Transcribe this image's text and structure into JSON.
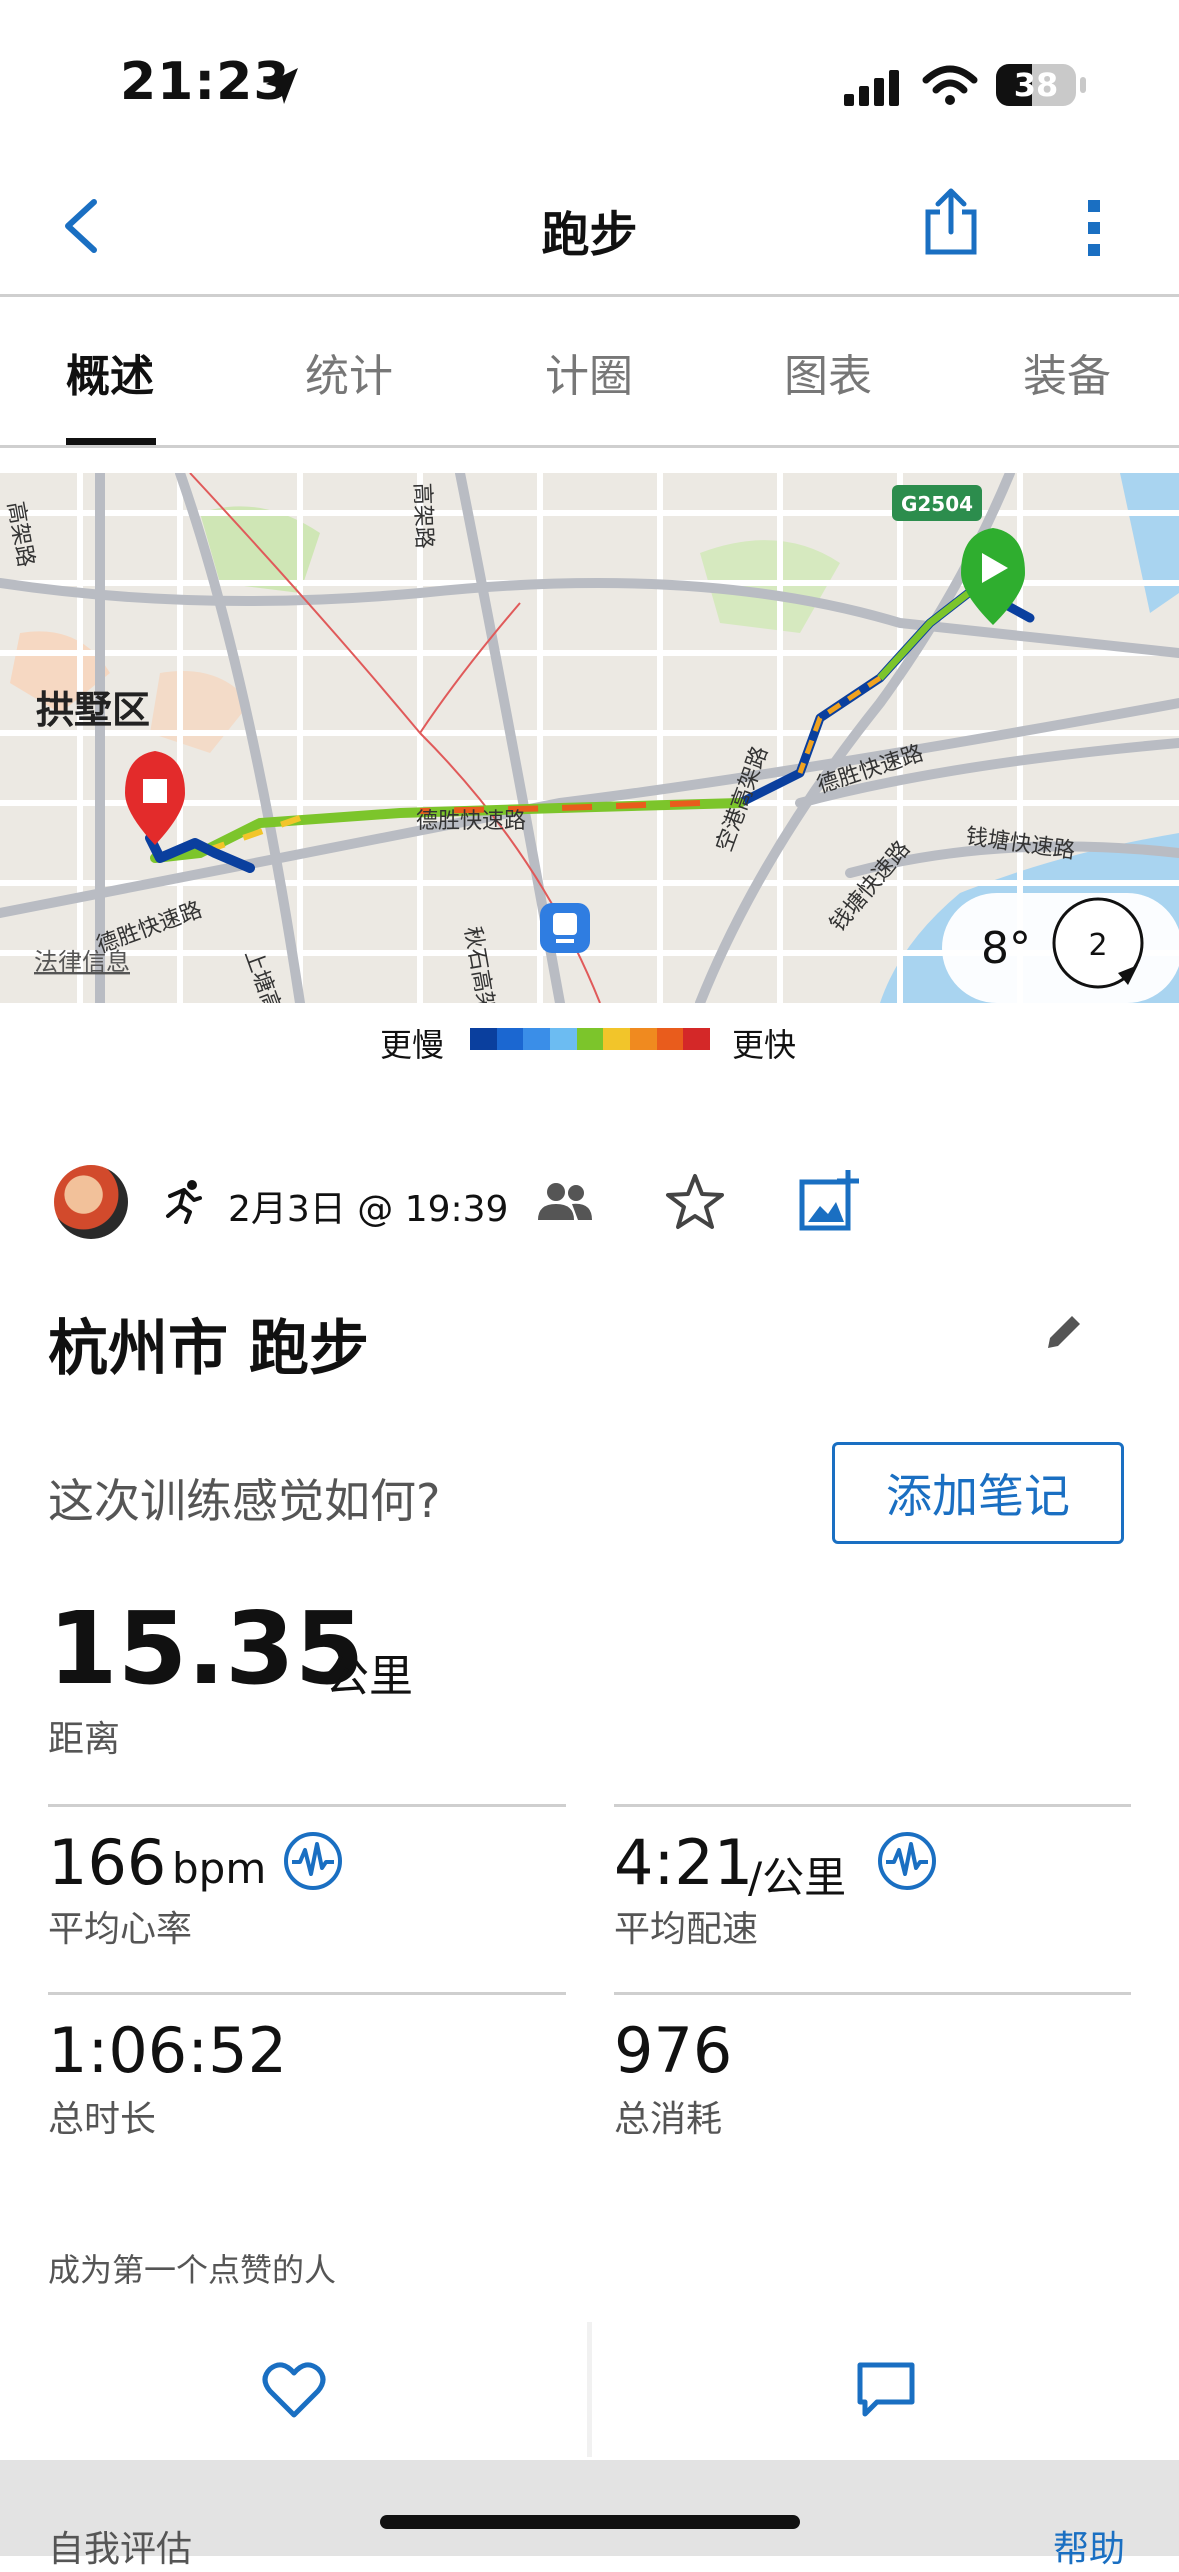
{
  "status_bar": {
    "time": "21:23",
    "battery": "38"
  },
  "header": {
    "title": "跑步"
  },
  "tabs": [
    {
      "label": "概述",
      "active": true
    },
    {
      "label": "统计",
      "active": false
    },
    {
      "label": "计圈",
      "active": false
    },
    {
      "label": "图表",
      "active": false
    },
    {
      "label": "装备",
      "active": false
    }
  ],
  "map": {
    "district": "拱墅区",
    "road_shield": "G2504",
    "road_labels": [
      "德胜快速路",
      "德胜快速路",
      "德胜快速路",
      "上塘高架",
      "秋石高架",
      "空港高架路",
      "钱塘快速路",
      "钱塘快速路",
      "高架路",
      "高架路"
    ],
    "legal": "法律信息",
    "weather_temp": "8°",
    "wind": "2"
  },
  "legend": {
    "slow": "更慢",
    "fast": "更快",
    "colors": [
      "#0a3f9e",
      "#1b67d1",
      "#3a8ee8",
      "#6cbcf2",
      "#7cc52b",
      "#f2c52a",
      "#f08a1f",
      "#e95c1c",
      "#d42828"
    ]
  },
  "activity": {
    "date": "2月3日 @ 19:39",
    "title": "杭州市 跑步",
    "feeling_question": "这次训练感觉如何?",
    "add_note": "添加笔记"
  },
  "stats": {
    "distance": {
      "value": "15.35",
      "unit": "公里",
      "label": "距离"
    },
    "heart_rate": {
      "value": "166",
      "unit": "bpm",
      "label": "平均心率"
    },
    "pace": {
      "value": "4:21",
      "unit": "/公里",
      "label": "平均配速"
    },
    "duration": {
      "value": "1:06:52",
      "label": "总时长"
    },
    "calories": {
      "value": "976",
      "label": "总消耗"
    }
  },
  "social": {
    "like_prompt": "成为第一个点赞的人"
  },
  "bottom_section": {
    "left": "自我评估",
    "right": "帮助"
  },
  "colors": {
    "accent": "#1a6fc2",
    "start": "#2fae2f",
    "end": "#e32b2b"
  }
}
